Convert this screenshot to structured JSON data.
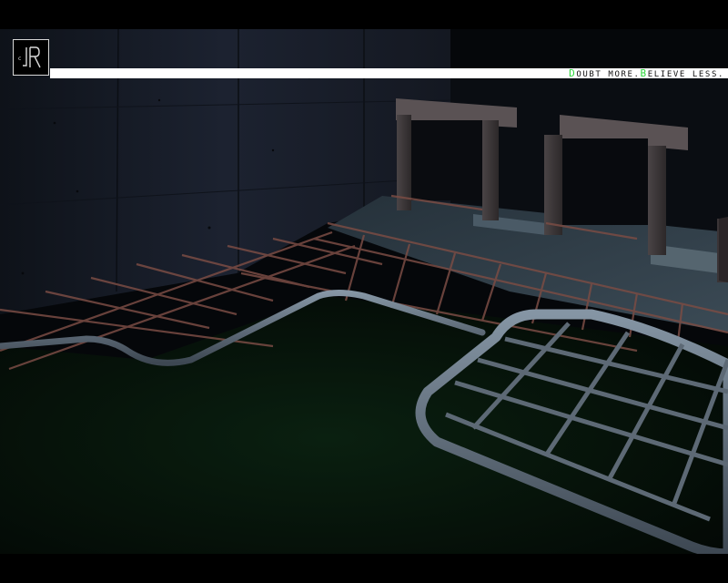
{
  "hud": {
    "logo_icon": "jr-logo-icon",
    "motto": {
      "part1_initial": "D",
      "part1_rest": "OUBT MORE.",
      "part2_initial": "B",
      "part2_rest": "ELIEVE LESS."
    },
    "colors": {
      "bar": "#ffffff",
      "motto_text": "#111111",
      "motto_initials": "#2bd63a",
      "logo_border": "#d8d8d8"
    }
  },
  "scene": {
    "description_icons": [
      "concrete-wall",
      "rusty-railing",
      "pipe-loop",
      "metal-grate-floor",
      "doorway-frame"
    ],
    "colors": {
      "wall": "#1c2230",
      "floor": "#2e3b44",
      "water": "#06120a",
      "rail": "#8a5a50",
      "pipe": "#6d7a88"
    }
  }
}
